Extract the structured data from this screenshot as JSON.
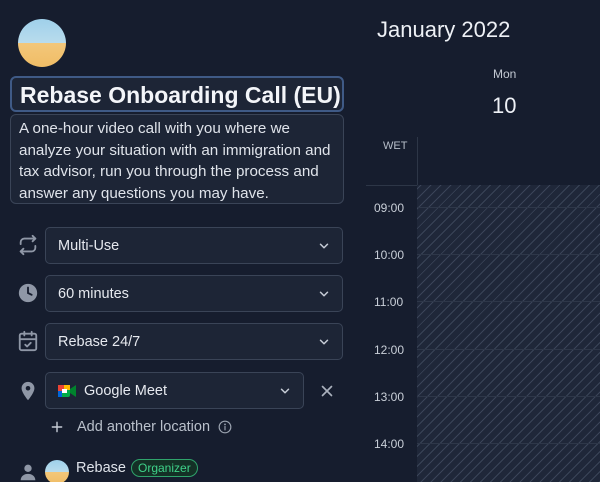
{
  "event": {
    "title": "Rebase Onboarding Call (EU)",
    "description": "A one-hour video call with you where we analyze your situation with an immigration and tax advisor, run you through the process and answer any questions you may have."
  },
  "settings": {
    "type": {
      "value": "Multi-Use",
      "icon": "repeat-icon"
    },
    "duration": {
      "value": "60 minutes",
      "icon": "clock-icon"
    },
    "schedule": {
      "value": "Rebase 24/7",
      "icon": "calendar-check-icon"
    },
    "location": {
      "value": "Google Meet",
      "icon": "map-pin-icon"
    }
  },
  "add_location_label": "Add another location",
  "host": {
    "name": "Rebase",
    "badge": "Organizer"
  },
  "calendar": {
    "month": "January 2022",
    "weekday": "Mon",
    "date": "10",
    "timezone": "WET",
    "times": [
      "09:00",
      "10:00",
      "11:00",
      "12:00",
      "13:00",
      "14:00"
    ]
  },
  "colors": {
    "background": "#161d2e",
    "field_background": "#1d2536",
    "field_border": "#3a4457",
    "focus_border": "#3f5a86",
    "badge_green": "#3fd28a"
  }
}
